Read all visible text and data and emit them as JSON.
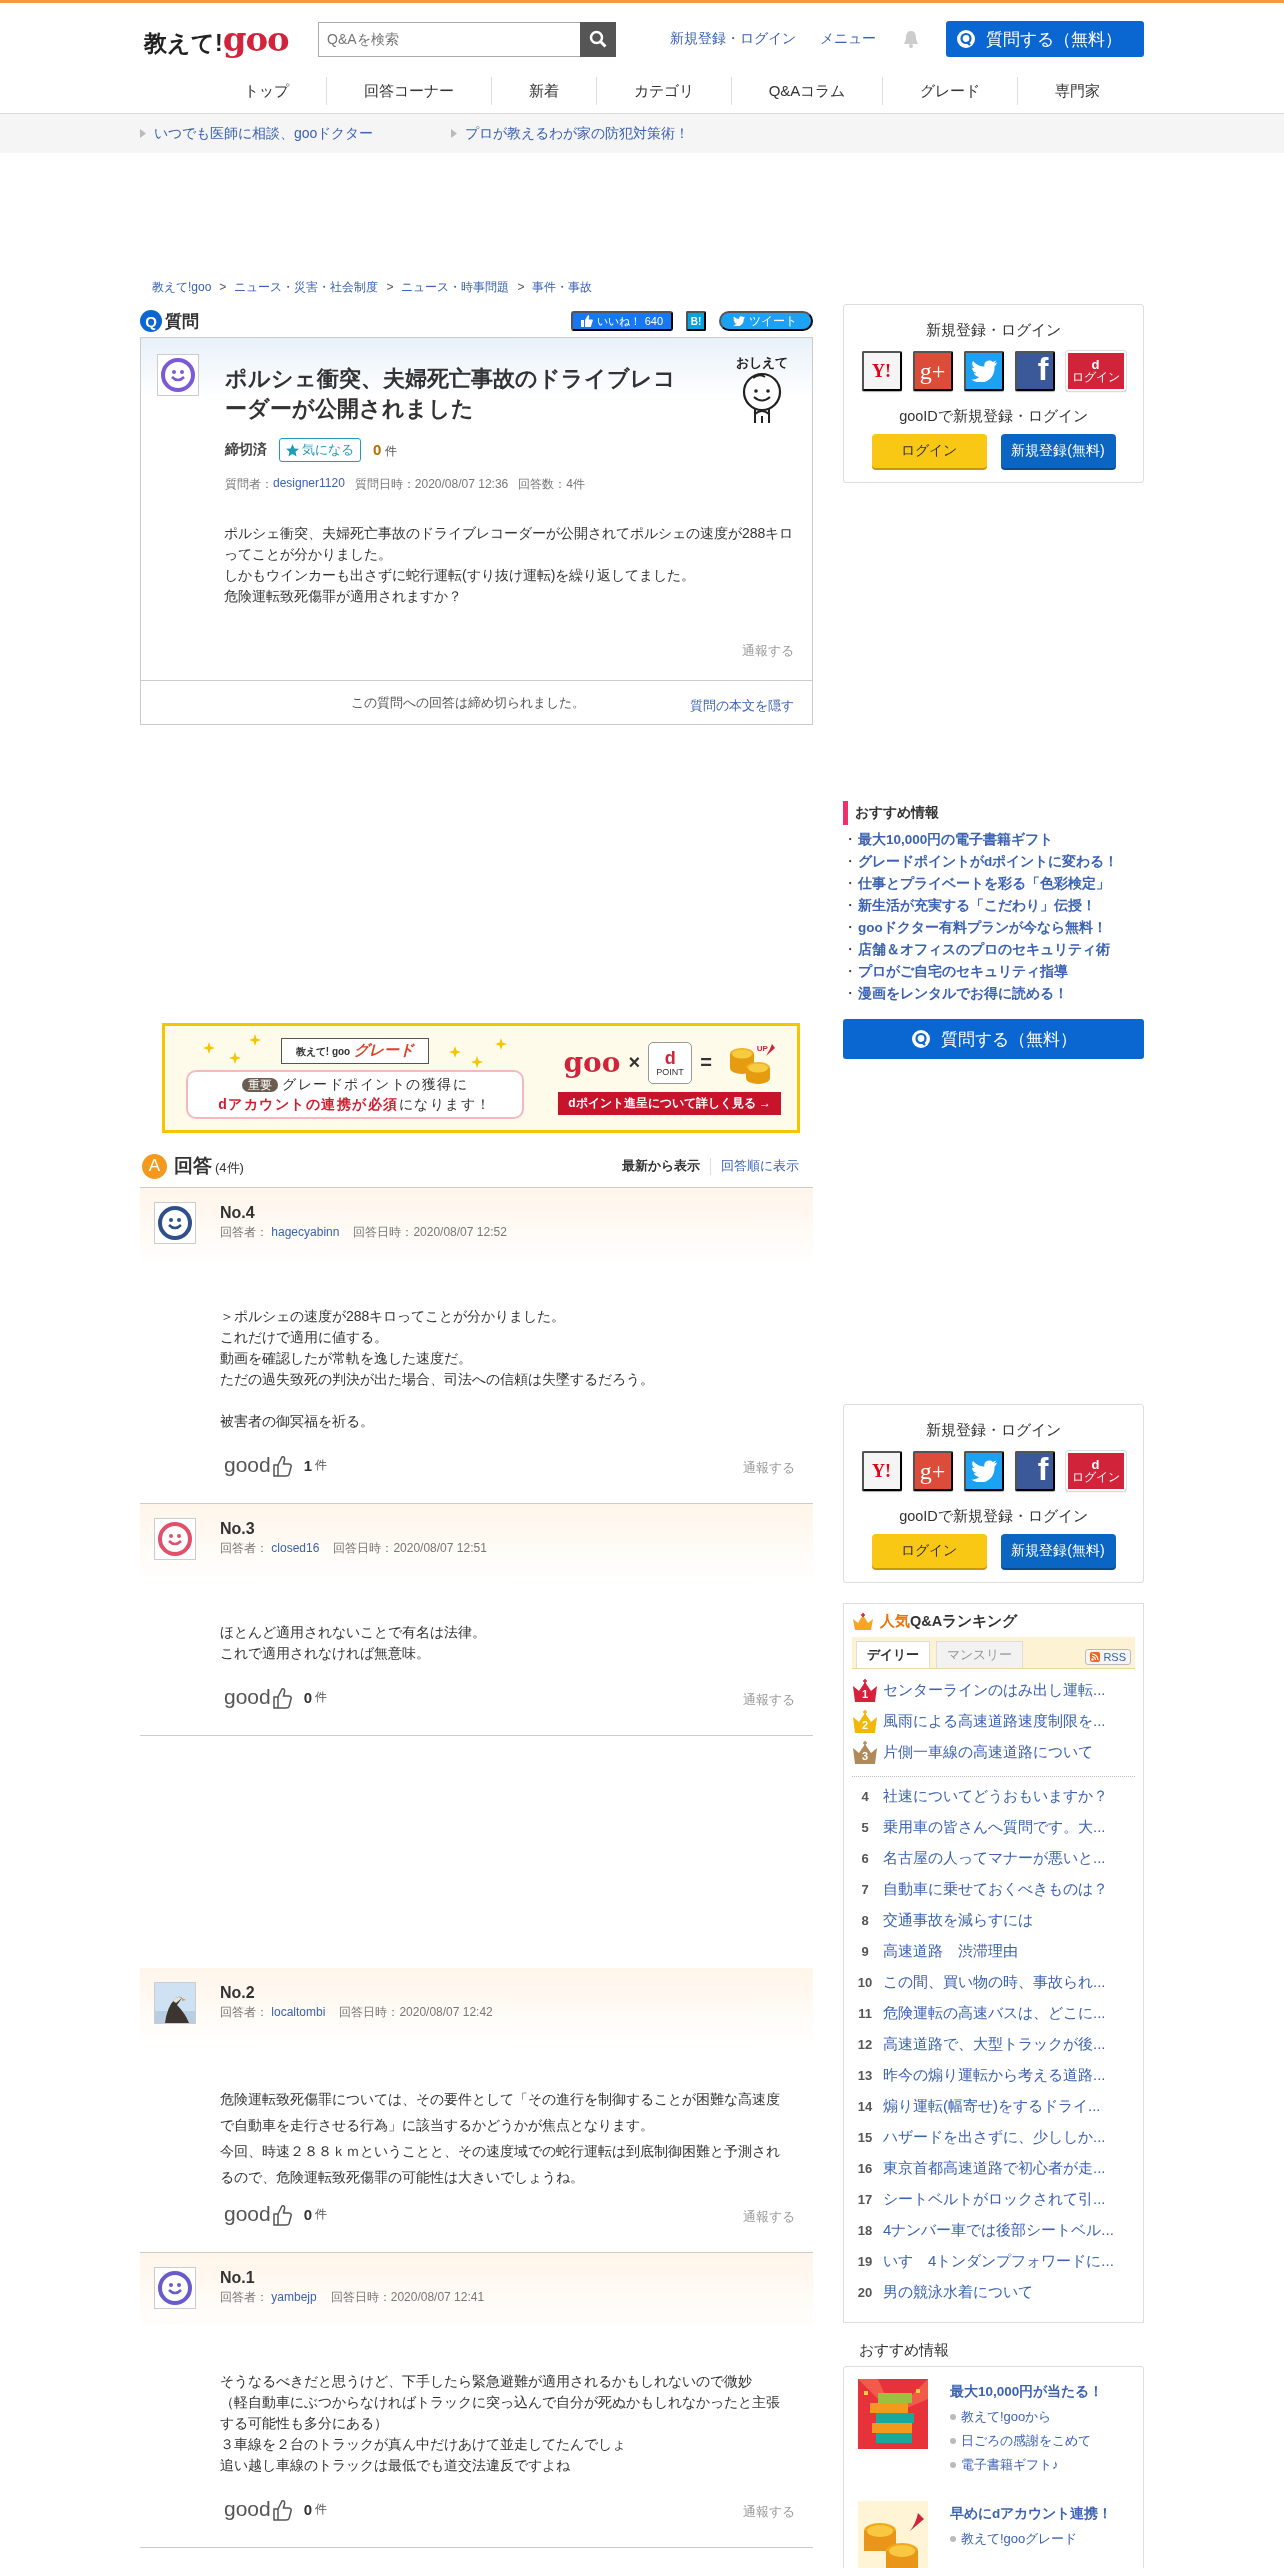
{
  "header": {
    "logo_text": "教えて!",
    "logo_brand": "goo",
    "search": {
      "placeholder": "Q&Aを検索"
    },
    "links": [
      "新規登録・ログイン",
      "メニュー"
    ],
    "ask_button": "質問する（無料）"
  },
  "nav": [
    "トップ",
    "回答コーナー",
    "新着",
    "カテゴリ",
    "Q&Aコラム",
    "グレード",
    "専門家"
  ],
  "promo_links": [
    "いつでも医師に相談、gooドクター",
    "プロが教えるわが家の防犯対策術！"
  ],
  "breadcrumb": [
    "教えて!goo",
    "ニュース・災害・社会制度",
    "ニュース・時事問題",
    "事件・事故"
  ],
  "breadcrumb_separator": ">",
  "question": {
    "badge": "Q",
    "label": "質問",
    "like_label": "いいね！",
    "like_count": "640",
    "hatena": "B!",
    "tweet": "ツイート",
    "title": "ポルシェ衝突、夫婦死亡事故のドライブレコーダーが公開されました",
    "character_caption": "おしえて",
    "status": "締切済",
    "watch_button": "気になる",
    "watch_count": "0",
    "count_unit": "件",
    "asker_label": "質問者：",
    "asker": "designer1120",
    "date": "質問日時：2020/08/07 12:36",
    "answer_count": "回答数：4件",
    "body": [
      [
        "ポルシェ衝突、夫婦死亡事故のドライブレコーダーが公開されてポルシェの速度が288キロってことが分かりました。",
        "しかもウインカーも出さずに蛇行運転(すり抜け運転)を繰り返してました。",
        "危険運転致死傷罪が適用されますか？"
      ]
    ],
    "report": "通報する",
    "closed_notice": "この質問への回答は締め切られました。",
    "hide_link": "質問の本文を隠す"
  },
  "banner": {
    "ribbon_text": "教えて! goo",
    "ribbon_title": "グレード",
    "badge": "重要",
    "line1": "グレードポイントの獲得に",
    "line2": "**dアカウントの連携が必須**になります！",
    "brand": "goo",
    "times": "×",
    "dpoint_letter": "d",
    "dpoint_label": "POINT",
    "equals": "=",
    "up": "UP",
    "cta": "dポイント進呈について詳しく見る →"
  },
  "answers_header": {
    "badge": "A",
    "title": "回答",
    "count": "(4件)",
    "sort": [
      {
        "label": "最新から表示",
        "selected": true
      },
      {
        "label": "回答順に表示",
        "selected": false
      }
    ]
  },
  "answers": [
    {
      "no": "No.4",
      "avatar": {
        "kind": "smiley",
        "color": "#2f4f8a"
      },
      "answerer_label": "回答者：",
      "answerer": "hagecyabinn",
      "date": "回答日時：2020/08/07 12:52",
      "body": [
        [
          "＞ポルシェの速度が288キロってことが分かりました。",
          "これだけで適用に値する。",
          "動画を確認したが常軌を逸した速度だ。",
          "ただの過失致死の判決が出た場合、司法への信頼は失墜するだろう。"
        ],
        [
          "被害者の御冥福を祈る。"
        ]
      ],
      "good": "good",
      "good_count": "1",
      "unit": "件",
      "report": "通報する"
    },
    {
      "no": "No.3",
      "avatar": {
        "kind": "smiley",
        "color": "#e0506a"
      },
      "answerer_label": "回答者：",
      "answerer": "closed16",
      "date": "回答日時：2020/08/07 12:51",
      "body": [
        [
          "ほとんど適用されないことで有名は法律。",
          "これで適用されなければ無意味。"
        ]
      ],
      "good": "good",
      "good_count": "0",
      "unit": "件",
      "report": "通報する"
    },
    {
      "no": "No.2",
      "avatar": {
        "kind": "picture"
      },
      "answerer_label": "回答者：",
      "answerer": "localtombi",
      "date": "回答日時：2020/08/07 12:42",
      "body": [
        [
          "危険運転致死傷罪については、その要件として「その進行を制御することが困難な高速度で自動車を走行させる行為」に該当するかどうかが焦点となります。"
        ],
        [
          "今回、時速２８８ｋｍということと、その速度域での蛇行運転は到底制御困難と予測されるので、危険運転致死傷罪の可能性は大きいでしょうね。"
        ]
      ],
      "good": "good",
      "good_count": "0",
      "unit": "件",
      "report": "通報する"
    },
    {
      "no": "No.1",
      "avatar": {
        "kind": "smiley",
        "color": "#6a5acd"
      },
      "answerer_label": "回答者：",
      "answerer": "yambejp",
      "date": "回答日時：2020/08/07 12:41",
      "body": [
        [
          "そうなるべきだと思うけど、下手したら緊急避難が適用されるかもしれないので微妙",
          "（軽自動車にぶつからなければトラックに突っ込んで自分が死ぬかもしれなかったと主張する可能性も多分にある）",
          "３車線を２台のトラックが真ん中だけあけて並走してたんでしょ",
          "追い越し車線のトラックは最低でも道交法違反ですよね"
        ]
      ],
      "good": "good",
      "good_count": "0",
      "unit": "件",
      "report": "通報する"
    }
  ],
  "login_cards": [
    {
      "title": "新規登録・ログイン",
      "providers": [
        {
          "kind": "yahoo",
          "label": "Y!"
        },
        {
          "kind": "google",
          "label": "g+"
        },
        {
          "kind": "twitter"
        },
        {
          "kind": "facebook",
          "label": "f"
        },
        {
          "kind": "docomo",
          "label": "d",
          "sub": "ログイン"
        }
      ],
      "subtitle": "gooIDで新規登録・ログイン",
      "login": "ログイン",
      "register": "新規登録(無料)"
    },
    {
      "title": "新規登録・ログイン",
      "providers": [
        {
          "kind": "yahoo",
          "label": "Y!"
        },
        {
          "kind": "google",
          "label": "g+"
        },
        {
          "kind": "twitter"
        },
        {
          "kind": "facebook",
          "label": "f"
        },
        {
          "kind": "docomo",
          "label": "d",
          "sub": "ログイン"
        }
      ],
      "subtitle": "gooIDで新規登録・ログイン",
      "login": "ログイン",
      "register": "新規登録(無料)"
    }
  ],
  "recommend": {
    "title": "おすすめ情報",
    "bullet": "・",
    "items": [
      "最大10,000円の電子書籍ギフト",
      "グレードポイントがdポイントに変わる！",
      "仕事とプライベートを彩る「色彩検定」",
      "新生活が充実する「こだわり」伝授！",
      "gooドクター有料プランが今なら無料！",
      "店舗＆オフィスのプロのセキュリティ術",
      "プロがご自宅のセキュリティ指導",
      "漫画をレンタルでお得に読める！"
    ],
    "ask_button": "質問する（無料）"
  },
  "ranking": {
    "title_accent": "人気",
    "title": "Q&Aランキング",
    "tabs": [
      {
        "label": "デイリー",
        "selected": true
      },
      {
        "label": "マンスリー",
        "selected": false
      }
    ],
    "rss": "RSS",
    "top": [
      {
        "rank": "1",
        "color": "#d9203a",
        "title": "センターラインのはみ出し運転..."
      },
      {
        "rank": "2",
        "color": "#f2b707",
        "title": "風雨による高速道路速度制限を..."
      },
      {
        "rank": "3",
        "color": "#b08a5a",
        "title": "片側一車線の高速道路について"
      }
    ],
    "items": [
      {
        "rank": "4",
        "title": "社速についてどうおもいますか？"
      },
      {
        "rank": "5",
        "title": "乗用車の皆さんへ質問です。大..."
      },
      {
        "rank": "6",
        "title": "名古屋の人ってマナーが悪いと..."
      },
      {
        "rank": "7",
        "title": "自動車に乗せておくべきものは？"
      },
      {
        "rank": "8",
        "title": "交通事故を減らすには"
      },
      {
        "rank": "9",
        "title": "高速道路　渋滞理由"
      },
      {
        "rank": "10",
        "title": "この間、買い物の時、事故られ..."
      },
      {
        "rank": "11",
        "title": "危険運転の高速バスは、どこに..."
      },
      {
        "rank": "12",
        "title": "高速道路で、大型トラックが後..."
      },
      {
        "rank": "13",
        "title": "昨今の煽り運転から考える道路..."
      },
      {
        "rank": "14",
        "title": "煽り運転(幅寄せ)をするドライ..."
      },
      {
        "rank": "15",
        "title": "ハザードを出さずに、少ししか..."
      },
      {
        "rank": "16",
        "title": "東京首都高速道路で初心者が走..."
      },
      {
        "rank": "17",
        "title": "シートベルトがロックされて引..."
      },
      {
        "rank": "18",
        "title": "4ナンバー車では後部シートベル..."
      },
      {
        "rank": "19",
        "title": "いす　4トンダンプフォワードに..."
      },
      {
        "rank": "20",
        "title": "男の競泳水着について"
      }
    ]
  },
  "recommend_cards": {
    "title": "おすすめ情報",
    "cards": [
      {
        "title": "最大10,000円が当たる！",
        "links": [
          "教えて!gooから",
          "日ごろの感謝をこめて",
          "電子書籍ギフト♪"
        ]
      },
      {
        "title": "早めにdアカウント連携！",
        "links": [
          "教えて!gooグレード"
        ]
      }
    ]
  }
}
